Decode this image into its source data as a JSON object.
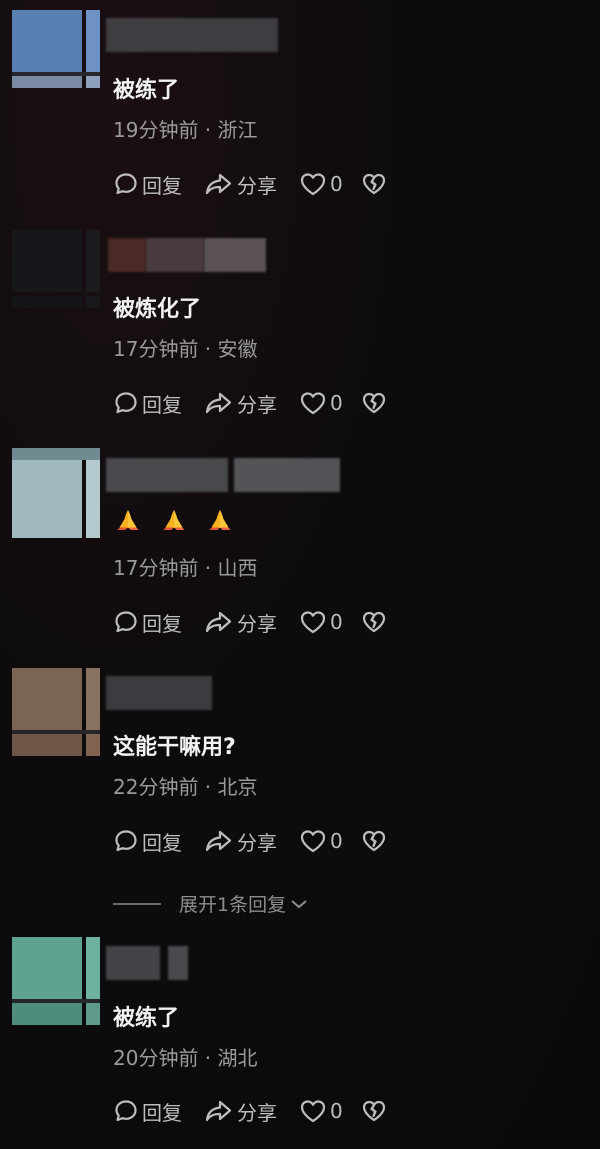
{
  "colors": {
    "background": "#0b0b0d",
    "text_primary": "#f2f2f3",
    "text_secondary": "#9a9a9e",
    "action": "#bdbdc0"
  },
  "actions": {
    "reply_label": "回复",
    "share_label": "分享",
    "like_count": "0"
  },
  "comments": [
    {
      "text": "被练了",
      "meta": "19分钟前 · 浙江"
    },
    {
      "text": "被炼化了",
      "meta": "17分钟前 · 安徽"
    },
    {
      "text": "🙏🙏🙏",
      "meta": "17分钟前 · 山西"
    },
    {
      "text": "这能干嘛用?",
      "meta": "22分钟前 · 北京"
    },
    {
      "text": "被练了",
      "meta": "20分钟前 · 湖北"
    }
  ],
  "expand_replies": {
    "label": "展开1条回复"
  }
}
